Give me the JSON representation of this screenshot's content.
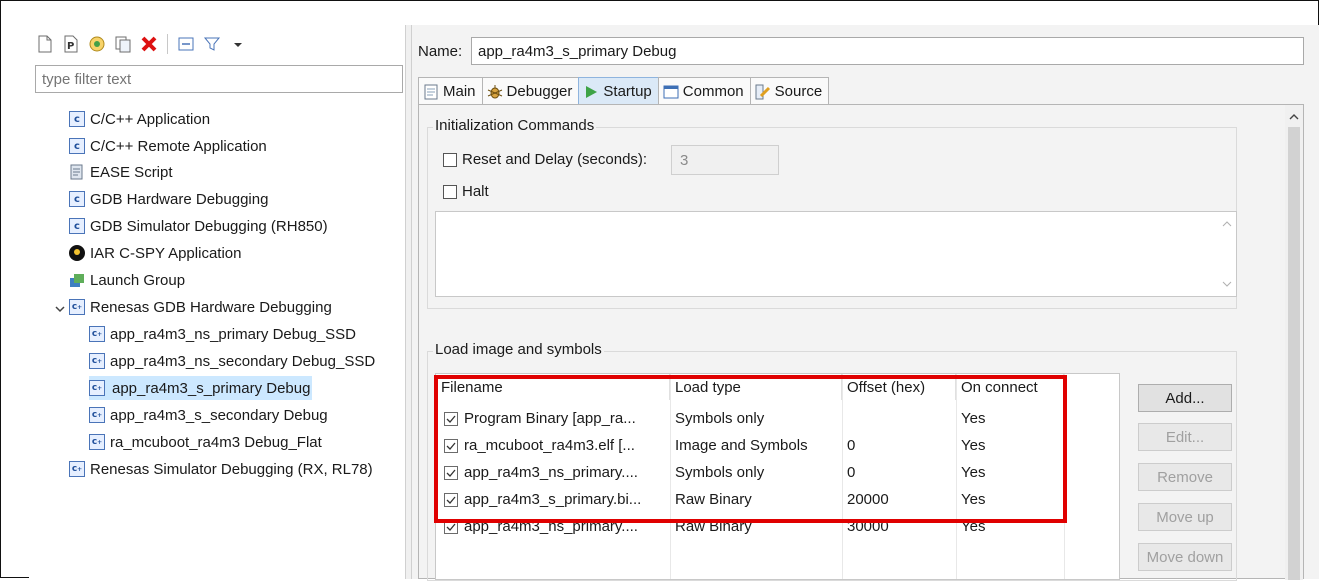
{
  "left": {
    "toolbar": {
      "icons": [
        "new-config-icon",
        "new-prototype-icon",
        "export-icon",
        "duplicate-icon",
        "delete-icon",
        "collapse-all-icon",
        "filter-icon",
        "view-menu-icon"
      ]
    },
    "filter_placeholder": "type filter text",
    "tree": [
      {
        "label": "C/C++ Application",
        "icon": "c-app-icon"
      },
      {
        "label": "C/C++ Remote Application",
        "icon": "c-app-icon"
      },
      {
        "label": "EASE Script",
        "icon": "script-icon"
      },
      {
        "label": "GDB Hardware Debugging",
        "icon": "c-app-icon"
      },
      {
        "label": "GDB Simulator Debugging (RH850)",
        "icon": "c-app-icon"
      },
      {
        "label": "IAR C-SPY Application",
        "icon": "iar-icon"
      },
      {
        "label": "Launch Group",
        "icon": "launch-group-icon"
      },
      {
        "label": "Renesas GDB Hardware Debugging",
        "icon": "c-app-icon",
        "expanded": true
      },
      {
        "label": "app_ra4m3_ns_primary Debug_SSD",
        "icon": "launch-config-icon"
      },
      {
        "label": "app_ra4m3_ns_secondary Debug_SSD",
        "icon": "launch-config-icon"
      },
      {
        "label": "app_ra4m3_s_primary Debug",
        "icon": "launch-config-icon",
        "selected": true
      },
      {
        "label": "app_ra4m3_s_secondary Debug",
        "icon": "launch-config-icon"
      },
      {
        "label": "ra_mcuboot_ra4m3 Debug_Flat",
        "icon": "launch-config-icon"
      },
      {
        "label": "Renesas Simulator Debugging (RX, RL78)",
        "icon": "c-app-icon"
      }
    ]
  },
  "right": {
    "name_label": "Name:",
    "name_value": "app_ra4m3_s_primary Debug",
    "tabs": [
      {
        "label": "Main",
        "icon": "main-tab-icon"
      },
      {
        "label": "Debugger",
        "icon": "debugger-tab-icon"
      },
      {
        "label": "Startup",
        "icon": "startup-tab-icon",
        "active": true
      },
      {
        "label": "Common",
        "icon": "common-tab-icon"
      },
      {
        "label": "Source",
        "icon": "source-tab-icon"
      }
    ],
    "init": {
      "title": "Initialization Commands",
      "reset_label": "Reset and Delay (seconds):",
      "reset_checked": false,
      "delay_value": "3",
      "halt_label": "Halt",
      "halt_checked": false
    },
    "load": {
      "title": "Load image and symbols",
      "columns": [
        "Filename",
        "Load type",
        "Offset (hex)",
        "On connect"
      ],
      "rows": [
        {
          "checked": true,
          "filename": "Program Binary [app_ra...",
          "load_type": "Symbols only",
          "offset": "",
          "on_connect": "Yes"
        },
        {
          "checked": true,
          "filename": "ra_mcuboot_ra4m3.elf [...",
          "load_type": "Image and Symbols",
          "offset": "0",
          "on_connect": "Yes"
        },
        {
          "checked": true,
          "filename": "app_ra4m3_ns_primary....",
          "load_type": "Symbols only",
          "offset": "0",
          "on_connect": "Yes"
        },
        {
          "checked": true,
          "filename": "app_ra4m3_s_primary.bi...",
          "load_type": "Raw Binary",
          "offset": "20000",
          "on_connect": "Yes"
        },
        {
          "checked": true,
          "filename": "app_ra4m3_ns_primary....",
          "load_type": "Raw Binary",
          "offset": "30000",
          "on_connect": "Yes"
        }
      ],
      "buttons": {
        "add": "Add...",
        "edit": "Edit...",
        "remove": "Remove",
        "move_up": "Move up",
        "move_down": "Move down"
      }
    }
  },
  "colors": {
    "highlight": "#e00000",
    "selection": "#cce8ff",
    "active_tab": "#dbe9f7"
  }
}
